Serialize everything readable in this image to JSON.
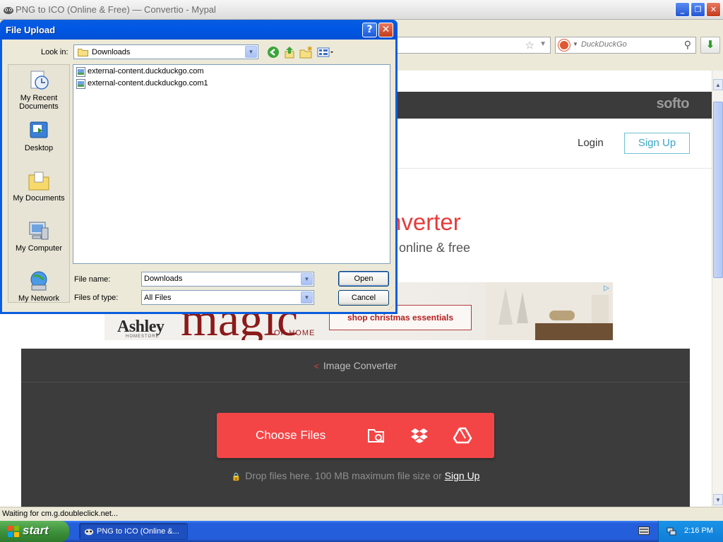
{
  "browser": {
    "window_title": "PNG to ICO (Online & Free) — Convertio - Mypal",
    "search": {
      "placeholder": "DuckDuckGo"
    },
    "status": "Waiting for cm.g.doubleclick.net..."
  },
  "page": {
    "logo": "softo",
    "nav": {
      "login": "Login",
      "signup": "Sign Up"
    },
    "hero": {
      "title_visible": "nverter",
      "subtitle_visible": "online & free"
    },
    "ad": {
      "brand": "Ashley",
      "brand_sub": "HOMESTORE",
      "headline": "magic",
      "tagline": "OF HOME",
      "cta": "shop christmas essentials"
    },
    "converter": {
      "breadcrumb": "Image Converter",
      "choose_files": "Choose Files",
      "drop_hint": "Drop files here. 100 MB maximum file size or",
      "drop_signup": "Sign Up"
    }
  },
  "dialog": {
    "title": "File Upload",
    "look_in_label": "Look in:",
    "look_in_value": "Downloads",
    "places": [
      {
        "label_line1": "My Recent",
        "label_line2": "Documents"
      },
      {
        "label_line1": "Desktop",
        "label_line2": ""
      },
      {
        "label_line1": "My Documents",
        "label_line2": ""
      },
      {
        "label_line1": "My Computer",
        "label_line2": ""
      },
      {
        "label_line1": "My Network",
        "label_line2": ""
      }
    ],
    "files": [
      "external-content.duckduckgo.com",
      "external-content.duckduckgo.com1"
    ],
    "file_name_label": "File name:",
    "file_name_value": "Downloads",
    "files_of_type_label": "Files of type:",
    "files_of_type_value": "All Files",
    "open_button": "Open",
    "cancel_button": "Cancel"
  },
  "taskbar": {
    "start": "start",
    "task_item": "PNG to ICO (Online &...",
    "clock": "2:16 PM"
  },
  "colors": {
    "brand_red": "#f44546",
    "signup_blue": "#3ba5c5",
    "xp_blue": "#0a5ddd",
    "taskbar_blue": "#245edb"
  }
}
